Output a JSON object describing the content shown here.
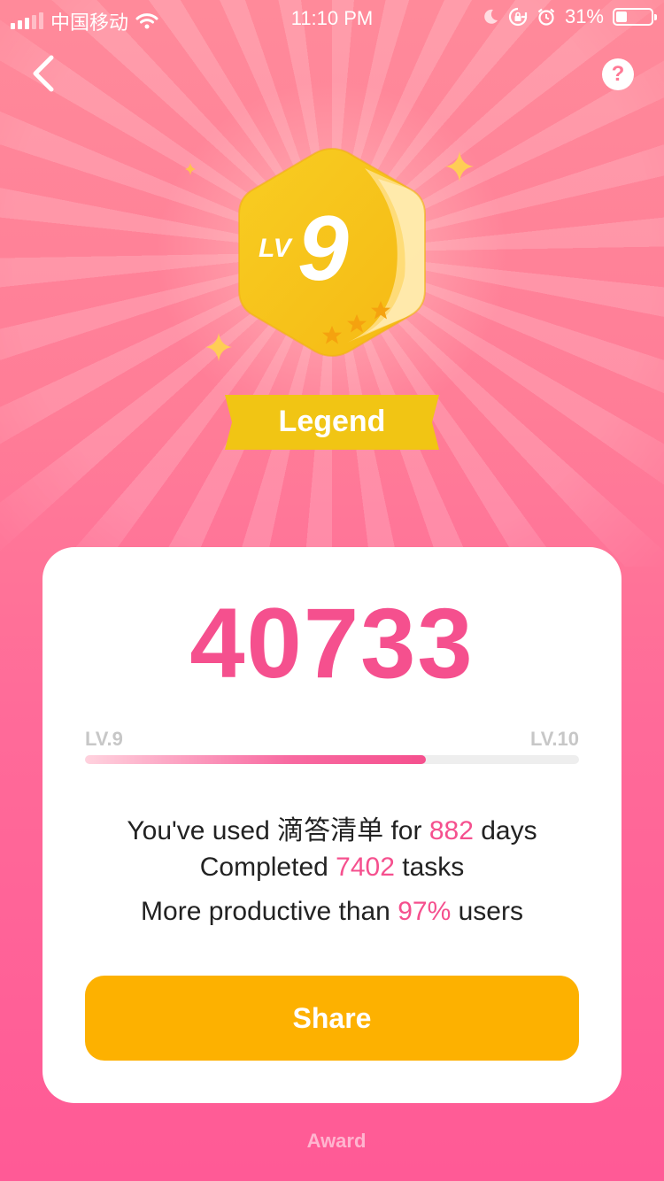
{
  "status_bar": {
    "carrier": "中国移动",
    "time": "11:10 PM",
    "battery_percent": "31%",
    "battery_level": 0.31,
    "icons": [
      "signal-icon",
      "wifi-icon",
      "moon-icon",
      "rotation-lock-icon",
      "alarm-icon",
      "battery-icon"
    ]
  },
  "nav": {
    "back_icon": "chevron-left-icon",
    "help_label": "?"
  },
  "badge": {
    "lv_prefix": "LV",
    "level_number": "9",
    "title": "Legend",
    "stars": 3
  },
  "card": {
    "score": "40733",
    "current_level_label": "LV.9",
    "next_level_label": "LV.10",
    "progress": 0.69,
    "line1": {
      "prefix": "You've used 滴答清单 for ",
      "value": "882",
      "suffix": " days"
    },
    "line2": {
      "prefix": "Completed ",
      "value": "7402",
      "suffix": " tasks"
    },
    "line3": {
      "prefix": "More productive than ",
      "value": "97%",
      "suffix": " users"
    },
    "share_label": "Share"
  },
  "footer": {
    "award_label": "Award"
  },
  "colors": {
    "accent_pink": "#f5508e",
    "share_orange": "#fdb100",
    "badge_gold": "#f8c41a"
  }
}
